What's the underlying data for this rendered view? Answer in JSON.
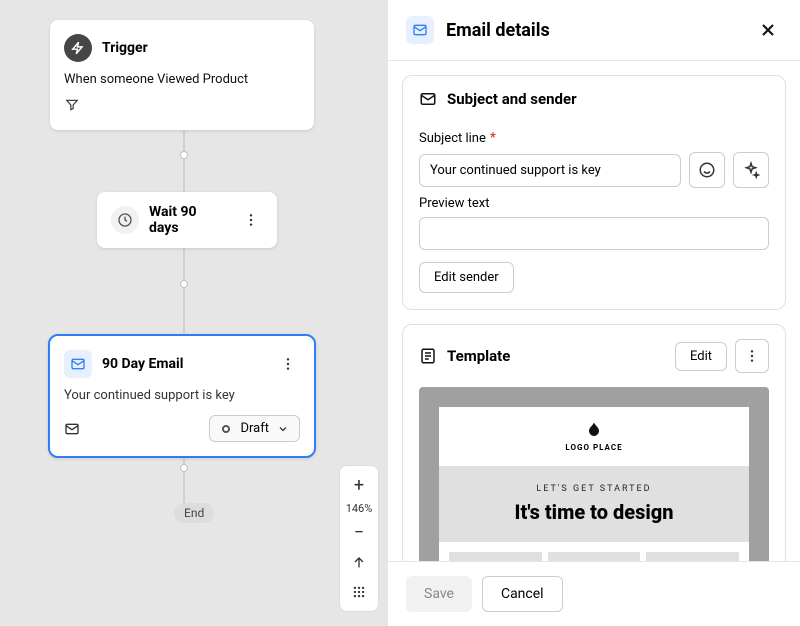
{
  "canvas": {
    "trigger": {
      "title": "Trigger",
      "description": "When someone Viewed Product"
    },
    "wait": {
      "label": "Wait 90 days"
    },
    "email": {
      "title": "90 Day Email",
      "description": "Your continued support is key",
      "status": "Draft"
    },
    "end": "End",
    "zoom": "146%"
  },
  "panel": {
    "title": "Email details",
    "subject_section": "Subject and sender",
    "subject_label": "Subject line",
    "subject_value": "Your continued support is key",
    "preview_label": "Preview text",
    "preview_value": "",
    "edit_sender": "Edit sender",
    "template_section": "Template",
    "edit": "Edit",
    "tmpl_logo": "LOGO PLACE",
    "tmpl_sub": "LET'S GET STARTED",
    "tmpl_heading": "It's time to design",
    "save": "Save",
    "cancel": "Cancel"
  }
}
